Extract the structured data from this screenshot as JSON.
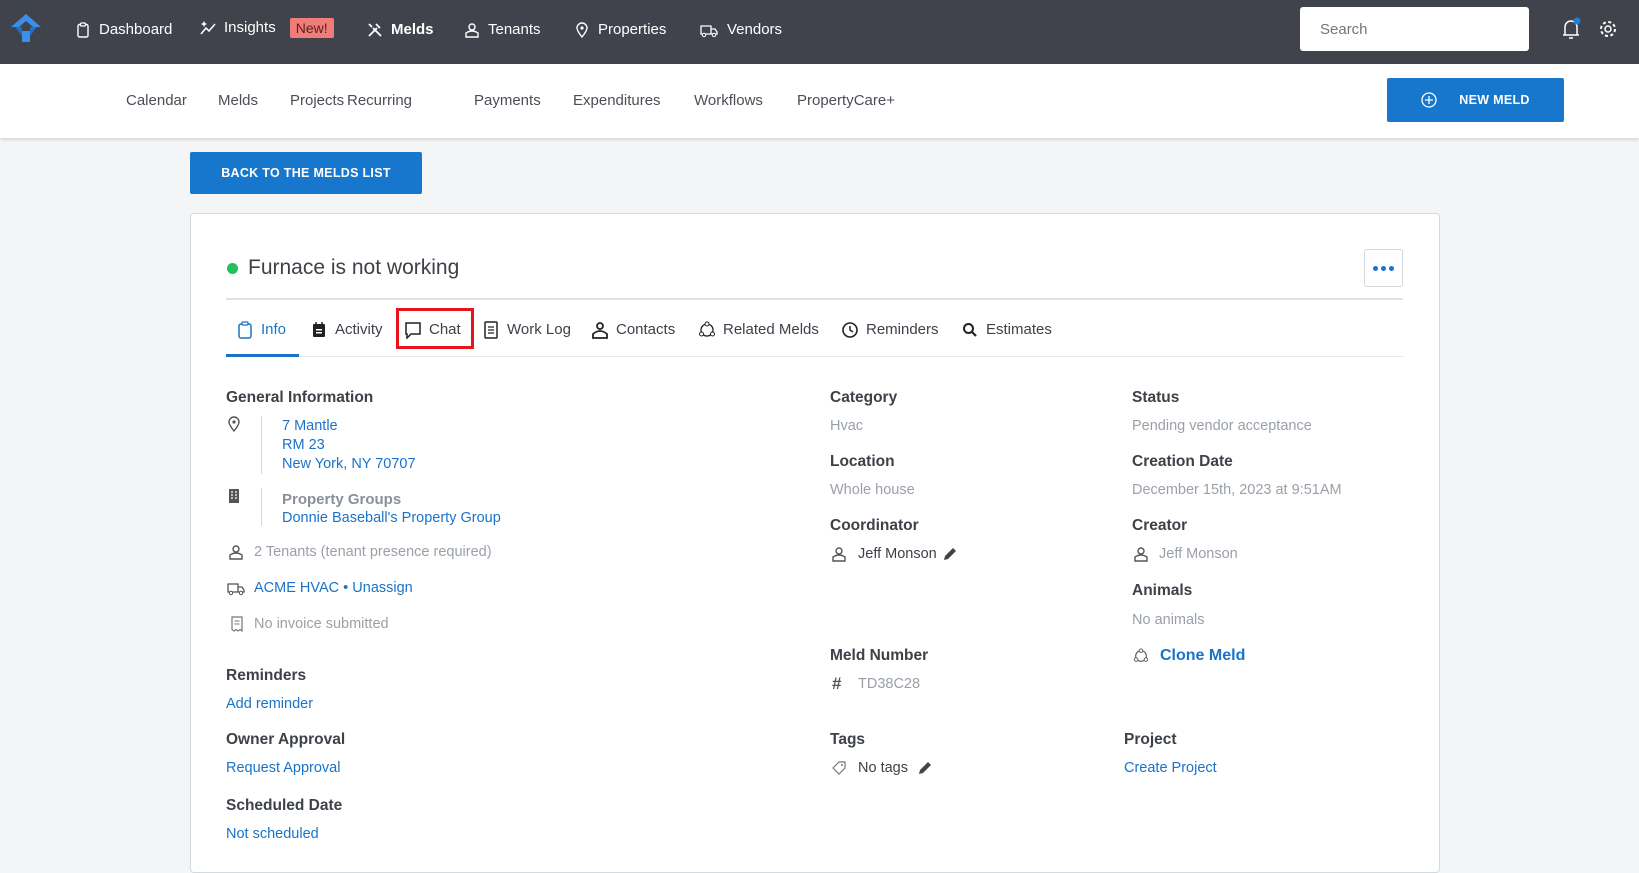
{
  "topnav": {
    "items": [
      {
        "label": "Dashboard",
        "icon": "clipboard-icon"
      },
      {
        "label": "Insights",
        "icon": "sparkle-chart-icon",
        "badge": "New!"
      },
      {
        "label": "Melds",
        "icon": "tools-icon"
      },
      {
        "label": "Tenants",
        "icon": "person-icon"
      },
      {
        "label": "Properties",
        "icon": "map-pin-icon"
      },
      {
        "label": "Vendors",
        "icon": "truck-icon"
      }
    ],
    "search_placeholder": "Search"
  },
  "subnav": {
    "items": [
      "Calendar",
      "Melds",
      "Projects",
      "Recurring",
      "Payments",
      "Expenditures",
      "Workflows",
      "PropertyCare+"
    ],
    "new_meld": "NEW MELD"
  },
  "back_button": "BACK TO THE MELDS LIST",
  "meld": {
    "title": "Furnace is not working",
    "status_color": "#1ec25b",
    "tabs": [
      "Info",
      "Activity",
      "Chat",
      "Work Log",
      "Contacts",
      "Related Melds",
      "Reminders",
      "Estimates"
    ],
    "general": {
      "heading": "General Information",
      "address": [
        "7 Mantle",
        "RM 23",
        "New York, NY 70707"
      ],
      "property_groups_label": "Property Groups",
      "property_group": "Donnie Baseball's Property Group",
      "tenants": "2 Tenants (tenant presence required)",
      "vendor": "ACME HVAC",
      "vendor_sep": "•",
      "unassign": "Unassign",
      "invoice": "No invoice submitted"
    },
    "reminders": {
      "heading": "Reminders",
      "link": "Add reminder"
    },
    "owner_approval": {
      "heading": "Owner Approval",
      "link": "Request Approval"
    },
    "scheduled": {
      "heading": "Scheduled Date",
      "link": "Not scheduled"
    },
    "category": {
      "heading": "Category",
      "value": "Hvac"
    },
    "location": {
      "heading": "Location",
      "value": "Whole house"
    },
    "coordinator": {
      "heading": "Coordinator",
      "value": "Jeff Monson"
    },
    "meld_number": {
      "heading": "Meld Number",
      "value": "TD38C28"
    },
    "tags": {
      "heading": "Tags",
      "value": "No tags"
    },
    "status": {
      "heading": "Status",
      "value": "Pending vendor acceptance"
    },
    "creation_date": {
      "heading": "Creation Date",
      "value": "December 15th, 2023 at 9:51AM"
    },
    "creator": {
      "heading": "Creator",
      "value": "Jeff Monson"
    },
    "animals": {
      "heading": "Animals",
      "value": "No animals"
    },
    "clone": "Clone Meld",
    "project": {
      "heading": "Project",
      "link": "Create Project"
    }
  }
}
